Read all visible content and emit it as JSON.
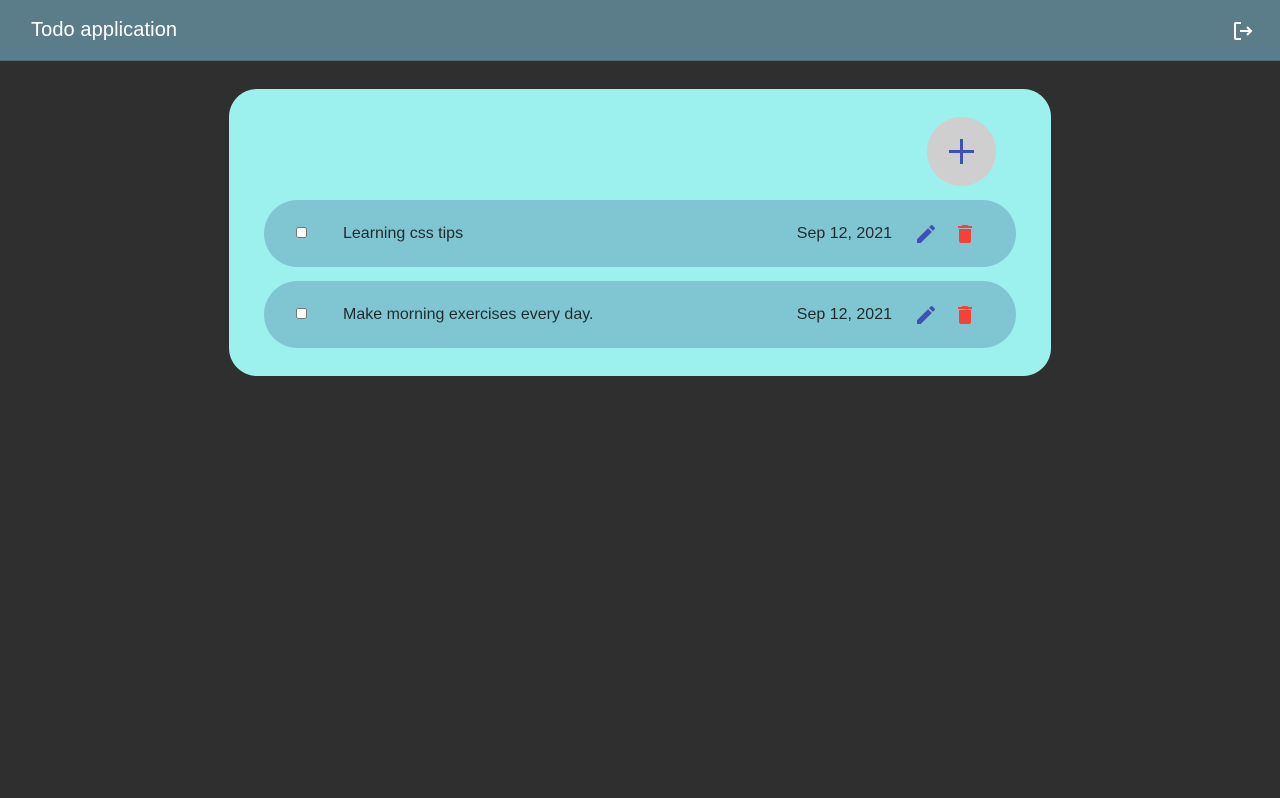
{
  "header": {
    "title": "Todo application",
    "logout_icon": "logout-icon"
  },
  "main": {
    "add_icon": "plus-icon",
    "todos": [
      {
        "text": "Learning css tips",
        "date": "Sep 12, 2021",
        "completed": false
      },
      {
        "text": "Make morning exercises every day.",
        "date": "Sep 12, 2021",
        "completed": false
      }
    ]
  },
  "colors": {
    "appbar": "#5b7d8a",
    "background": "#2f2f2f",
    "card": "#9cf1ee",
    "row": "#80c6d2",
    "accent": "#3f51b5",
    "delete": "#f44336"
  }
}
